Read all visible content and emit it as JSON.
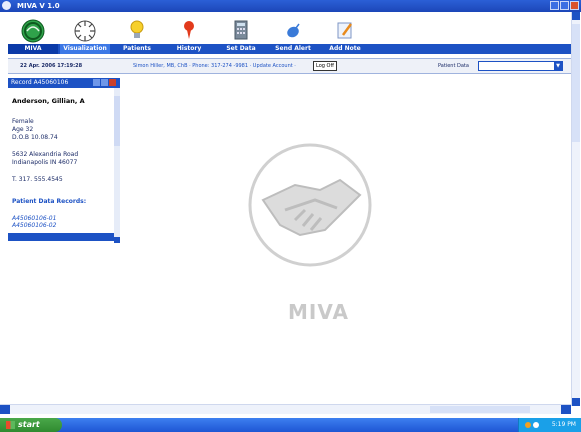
{
  "window": {
    "title": "MIVA V 1.0"
  },
  "toolbar": {
    "items": [
      {
        "label": "MIVA",
        "icon": "globe-icon"
      },
      {
        "label": "Visualization",
        "icon": "radial-dial-icon"
      },
      {
        "label": "Patients",
        "icon": "lightbulb-icon"
      },
      {
        "label": "History",
        "icon": "pin-icon"
      },
      {
        "label": "Set Data",
        "icon": "calculator-icon"
      },
      {
        "label": "Send Alert",
        "icon": "satellite-icon"
      },
      {
        "label": "Add Note",
        "icon": "notepad-icon"
      }
    ]
  },
  "infobar": {
    "date": "22 Apr. 2006 17:19:28",
    "contact": "Simon Hiller, MB, ChB  ·  Phone: 317-274 -9981  ·  Update Account  ·",
    "logoff": "Log Off",
    "patient_data_label": "Patient Data"
  },
  "record": {
    "title": "Record A45060106",
    "name": "Anderson, Gillian, A",
    "sex": "Female",
    "age": "Age 32",
    "dob": "D.O.B 10.08.74",
    "address1": "5632 Alexandria Road",
    "address2": "Indianapolis IN 46077",
    "phone": "T. 317. 555.4545",
    "records_heading": "Patient Data Records:",
    "records": [
      "A45060106-01",
      "A45060106-02"
    ]
  },
  "watermark": {
    "text": "MIVA"
  },
  "taskbar": {
    "start": "start",
    "clock": "5:19 PM"
  },
  "colors": {
    "accent": "#1d52c4",
    "title": "#1a2a66",
    "start": "#3a9a3a"
  }
}
